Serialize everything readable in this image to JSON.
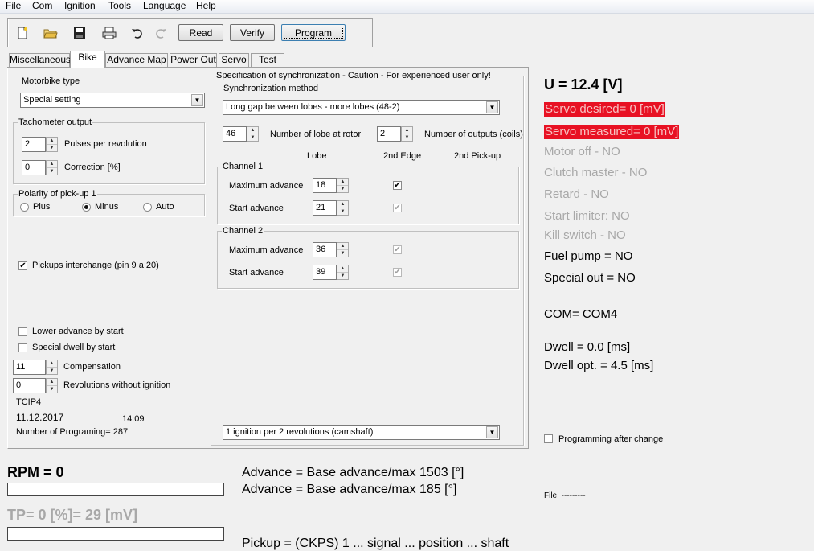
{
  "menu": {
    "file": "File",
    "com": "Com",
    "ignition": "Ignition",
    "tools": "Tools",
    "language": "Language",
    "help": "Help"
  },
  "toolbar": {
    "read": "Read",
    "verify": "Verify",
    "program": "Program"
  },
  "tabs": [
    "Miscellaneous",
    "Bike",
    "Advance Map",
    "Power Out",
    "Servo",
    "Test"
  ],
  "left": {
    "motorbike_label": "Motorbike type",
    "motorbike_value": "Special setting",
    "tacho_group": "Tachometer output",
    "pulses_value": "2",
    "pulses_label": "Pulses per revolution",
    "correction_value": "0",
    "correction_label": "Correction [%]",
    "polarity_group": "Polarity of pick-up 1",
    "plus": "Plus",
    "minus": "Minus",
    "auto": "Auto",
    "pickups_interchange": "Pickups interchange (pin 9 a 20)",
    "lower_advance": "Lower advance by start",
    "special_dwell": "Special dwell by start",
    "compensation_value": "11",
    "compensation_label": "Compensation",
    "revs_value": "0",
    "revs_label": "Revolutions without ignition",
    "device": "TCIP4",
    "date": "11.12.2017",
    "time": "14:09",
    "programming_count": "Number of Programing= 287"
  },
  "sync": {
    "group": "Specification of synchronization - Caution - For experienced user only!",
    "method_label": "Synchronization method",
    "method_value": "Long gap between lobes - more lobes (48-2)",
    "lobes_value": "46",
    "lobes_label": "Number of lobe at rotor",
    "outputs_value": "2",
    "outputs_label": "Number of outputs (coils)",
    "col_lobe": "Lobe",
    "col_edge": "2nd Edge",
    "col_pickup": "2nd Pick-up",
    "channel1": "Channel 1",
    "channel2": "Channel 2",
    "max_adv": "Maximum advance",
    "start_adv": "Start advance",
    "ch1_max": "18",
    "ch1_start": "21",
    "ch2_max": "36",
    "ch2_start": "39",
    "ignition_mode": "1 ignition per 2 revolutions (camshaft)"
  },
  "status": {
    "voltage": "U = 12.4 [V]",
    "servo_desired": "Servo desired= 0 [mV]",
    "servo_measured": "Servo measured= 0 [mV]",
    "motor_off": "Motor off - NO",
    "clutch": "Clutch master - NO",
    "retard": "Retard - NO",
    "start_limiter": "Start limiter: NO",
    "kill_switch": "Kill switch - NO",
    "fuel_pump": "Fuel pump = NO",
    "special_out": "Special out = NO",
    "com": "COM= COM4",
    "dwell": "Dwell = 0.0 [ms]",
    "dwell_opt": "Dwell opt. = 4.5 [ms]",
    "prog_after_change": "Programming after change",
    "file": "File:  ---------"
  },
  "bottom": {
    "rpm": "RPM = 0",
    "tp": "TP= 0 [%]= 29 [mV]",
    "advance1": "Advance = Base advance/max 1503 [°]",
    "advance2": "Advance = Base advance/max 185 [°]",
    "cut_text": "Pickup = (CKPS) 1 ... signal ... position ... shaft"
  },
  "colors": {
    "red": "#e81123",
    "gray_text": "#a8a8a8"
  }
}
